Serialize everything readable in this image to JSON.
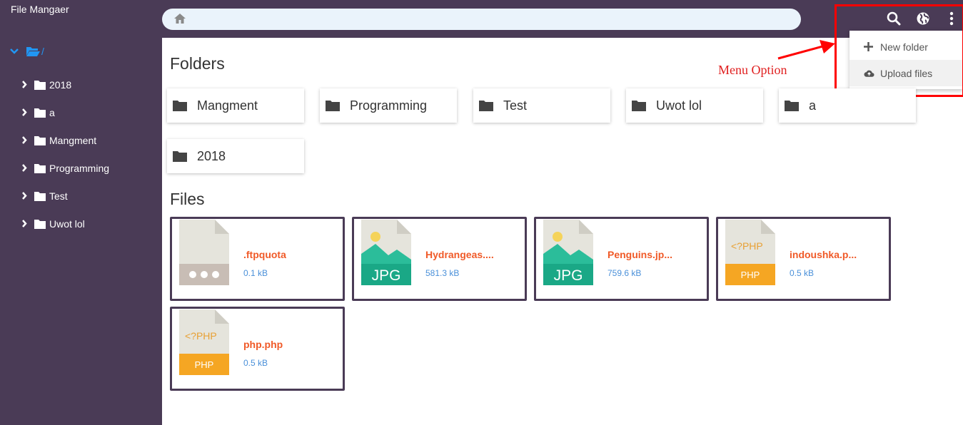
{
  "app": {
    "title": "File Mangaer"
  },
  "tree": {
    "root_label": "/",
    "items": [
      {
        "label": "2018"
      },
      {
        "label": "a"
      },
      {
        "label": "Mangment"
      },
      {
        "label": "Programming"
      },
      {
        "label": "Test"
      },
      {
        "label": "Uwot lol"
      }
    ]
  },
  "menu": {
    "items": [
      {
        "label": "New folder",
        "icon": "plus-icon"
      },
      {
        "label": "Upload files",
        "icon": "cloud-upload-icon"
      }
    ]
  },
  "annotation": {
    "text": "Menu Option",
    "color": "#ff0000"
  },
  "main": {
    "folders_title": "Folders",
    "files_title": "Files",
    "folders": [
      {
        "name": "Mangment"
      },
      {
        "name": "Programming"
      },
      {
        "name": "Test"
      },
      {
        "name": "Uwot lol"
      },
      {
        "name": "a"
      },
      {
        "name": "2018"
      }
    ],
    "files": [
      {
        "name": ".ftpquota",
        "size": "0.1 kB",
        "type": "generic"
      },
      {
        "name": "Hydrangeas....",
        "size": "581.3 kB",
        "type": "jpg",
        "badge": "JPG"
      },
      {
        "name": "Penguins.jp...",
        "size": "759.6 kB",
        "type": "jpg",
        "badge": "JPG"
      },
      {
        "name": "indoushka.p...",
        "size": "0.5 kB",
        "type": "php",
        "code": "<?PHP",
        "badge": "PHP"
      },
      {
        "name": "php.php",
        "size": "0.5 kB",
        "type": "php",
        "code": "<?PHP",
        "badge": "PHP"
      }
    ]
  },
  "colors": {
    "sidebar": "#4a3b56",
    "accent_blue": "#2196f3",
    "file_name": "#f05a28",
    "file_size": "#4a90d9",
    "jpg_green": "#1aa886",
    "php_orange": "#f5a623"
  }
}
